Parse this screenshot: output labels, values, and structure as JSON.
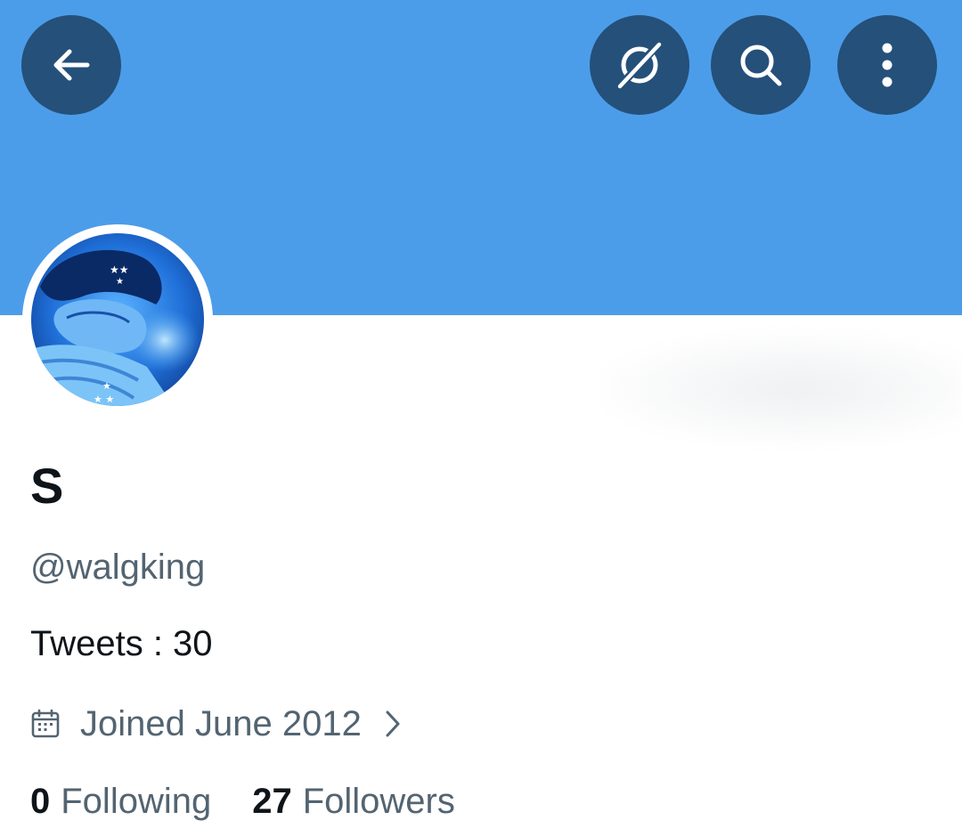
{
  "header": {
    "icons": {
      "back": "back-arrow-icon",
      "grok": "grok-icon",
      "search": "search-icon",
      "more": "more-vertical-icon"
    },
    "banner_color": "#4c9de9",
    "button_color": "#24507a"
  },
  "profile": {
    "display_name": "S",
    "handle": "@walgking",
    "tweets_text": "Tweets : 30",
    "joined_text": "Joined June 2012",
    "joined_icon": "calendar-icon",
    "following": {
      "count": "0",
      "label": "Following"
    },
    "followers": {
      "count": "27",
      "label": "Followers"
    }
  }
}
